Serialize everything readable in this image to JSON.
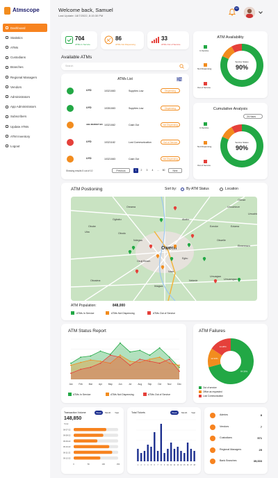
{
  "app": {
    "name": "Atmscope",
    "brand_color": "#f7831f",
    "navy": "#1c2f8f"
  },
  "sidebar": {
    "items": [
      {
        "label": "Dashboard",
        "active": true
      },
      {
        "label": "Statistics"
      },
      {
        "label": "ATMs"
      },
      {
        "label": "Custodians"
      },
      {
        "label": "Branches"
      },
      {
        "label": "Regional Managers"
      },
      {
        "label": "Vendors"
      },
      {
        "label": "Administrators"
      },
      {
        "label": "App Administrators"
      },
      {
        "label": "Subscribers"
      },
      {
        "label": "Update ATMs"
      },
      {
        "label": "ATM Inventory"
      },
      {
        "label": "Logout"
      }
    ]
  },
  "header": {
    "welcome": "Welcome back, Samuel",
    "last_update": "Last Update: 18/7/2022, 8:15:30 PM",
    "notifications": "10"
  },
  "stats": [
    {
      "value": "704",
      "label": "ATMs In Service",
      "color": "#22a845"
    },
    {
      "value": "86",
      "label": "ATMs Not Dispensing",
      "color": "#f28c1e"
    },
    {
      "value": "33",
      "label": "ATMs Out of Service",
      "color": "#e5403a"
    }
  ],
  "available": {
    "title": "Available ATMs",
    "search_placeholder": "Search",
    "list_title": "ATMs List",
    "rows": [
      {
        "status": "green",
        "bank": "UYD",
        "id": "10321083",
        "reason": "Supplies Low",
        "state": "Dispensing"
      },
      {
        "status": "green",
        "bank": "UYD",
        "id": "10351083",
        "reason": "Supplies Low",
        "state": "Dispensing"
      },
      {
        "status": "orange",
        "bank": "ABA MARKET BO",
        "id": "10321082",
        "reason": "Cash Out",
        "state": "Not Dispensing"
      },
      {
        "status": "red",
        "bank": "UYD",
        "id": "10321182",
        "reason": "Lost Communication",
        "state": "Out of Service"
      },
      {
        "status": "orange",
        "bank": "UYD",
        "id": "10321083",
        "reason": "Cash Out",
        "state": "Not Dispensing"
      }
    ],
    "showing": "Showing results 5 out of 10",
    "prev": "Previous",
    "pages": [
      "1",
      "2",
      "3",
      "4",
      "...",
      "50"
    ],
    "next": "Next"
  },
  "availability": {
    "title": "ATM Availability",
    "center_label": "Service Status",
    "center_value": "90%",
    "legend": [
      "In Service",
      "Not Dispensing",
      "Out of Service"
    ]
  },
  "cumulative": {
    "title": "Cumulative Analysis",
    "dropdown": "24 Hours",
    "center_label": "Service Status",
    "center_value": "90%",
    "legend": [
      "In Service",
      "Not Dispensing",
      "Out of Service"
    ]
  },
  "positioning": {
    "title": "ATM Postioning",
    "sort_label": "Sort by:",
    "opt1": "By ATM Status",
    "opt2": "Location",
    "population_label": "ATM Population:",
    "population_value": "848,000",
    "legend": [
      "ATMs In Service",
      "ATMs Not Dispensing",
      "ATMs Out of Service"
    ],
    "places": [
      "Oreama",
      "Umuchieze",
      "Umuchima",
      "Ogbaku",
      "Akabo",
      "Obube",
      "Uba",
      "Obodo",
      "Ndegwu",
      "Ezeoke",
      "Eziama",
      "Okwelle",
      "Ekwereazu",
      "Owerri",
      "Egbu",
      "Osuji Beach",
      "Naze",
      "Nekede",
      "Obosima",
      "Umuagwo",
      "Ihiagwa",
      "Obinze",
      "Umuamgwo"
    ],
    "map_land": "#c9e3c2",
    "map_road": "#ffffff"
  },
  "status_report": {
    "title": "ATM Status Report",
    "legend": [
      "ATMs In Service",
      "ATMs Not Dispensing",
      "ATMs Out of Service"
    ]
  },
  "failures": {
    "title": "ATM Failures",
    "legend": [
      "Out of service",
      "Office as requested",
      "Lost Communication"
    ],
    "slice_labels": [
      "64.56%",
      "12.34%",
      "14.28%"
    ]
  },
  "transactions": {
    "title": "Transaction Volume",
    "tabs": [
      "Week",
      "Month",
      "Year"
    ],
    "total_value": "148,850",
    "total_label": "Total",
    "bar_labels": [
      "06-07-22",
      "06-08-22",
      "06-09-22",
      "06-10-22",
      "06-11-22",
      "06-12-22"
    ],
    "x_ticks": [
      "0",
      "50",
      "100",
      "150"
    ]
  },
  "tickets": {
    "title": "Total Tickets",
    "tabs": [
      "Week",
      "Month",
      "Year"
    ]
  },
  "counts": [
    {
      "label": "Admins",
      "value": "8"
    },
    {
      "label": "Vendors",
      "value": "7"
    },
    {
      "label": "Custodians",
      "value": "571"
    },
    {
      "label": "Regional Managers",
      "value": "25"
    },
    {
      "label": "Bank Branches",
      "value": "35,003"
    }
  ],
  "chart_data": [
    {
      "type": "pie",
      "title": "ATM Availability",
      "categories": [
        "In Service",
        "Not Dispensing",
        "Out of Service"
      ],
      "values": [
        82,
        10,
        8
      ]
    },
    {
      "type": "pie",
      "title": "Cumulative Analysis",
      "categories": [
        "In Service",
        "Not Dispensing",
        "Out of Service"
      ],
      "values": [
        82,
        10,
        8
      ]
    },
    {
      "type": "area",
      "title": "ATM Status Report",
      "categories": [
        "Jan",
        "Feb",
        "Mar",
        "Apr",
        "May",
        "Jun",
        "Jul",
        "Aug",
        "Sep",
        "Oct",
        "Nov",
        "Dec"
      ],
      "series": [
        {
          "name": "ATMs In Service",
          "values": [
            40,
            55,
            58,
            70,
            62,
            90,
            68,
            72,
            60,
            78,
            55,
            30
          ]
        },
        {
          "name": "ATMs Not Dispensing",
          "values": [
            35,
            42,
            48,
            45,
            40,
            60,
            45,
            42,
            50,
            55,
            40,
            35
          ]
        },
        {
          "name": "ATMs Out of Service",
          "values": [
            15,
            25,
            30,
            40,
            60,
            55,
            35,
            50,
            45,
            40,
            50,
            20
          ]
        }
      ],
      "ylim": [
        0,
        100
      ]
    },
    {
      "type": "pie",
      "title": "ATM Failures",
      "categories": [
        "Out of service",
        "Office as requested",
        "Lost Communication"
      ],
      "values": [
        64.56,
        12.34,
        14.28
      ]
    },
    {
      "type": "bar",
      "title": "Transaction Volume",
      "categories": [
        "06-07-22",
        "06-08-22",
        "06-09-22",
        "06-10-22",
        "06-11-22",
        "06-12-22"
      ],
      "values": [
        110,
        100,
        80,
        120,
        130,
        90
      ],
      "xlim": [
        0,
        150
      ]
    },
    {
      "type": "bar",
      "title": "Total Tickets",
      "categories": [
        "1",
        "2",
        "3",
        "4",
        "5",
        "6",
        "7",
        "8",
        "9",
        "10",
        "11",
        "12",
        "13",
        "14",
        "15",
        "16",
        "17",
        "18"
      ],
      "values": [
        30,
        20,
        25,
        40,
        35,
        70,
        25,
        90,
        20,
        30,
        45,
        30,
        35,
        25,
        20,
        45,
        30,
        25
      ],
      "ylim": [
        0,
        100
      ]
    }
  ]
}
